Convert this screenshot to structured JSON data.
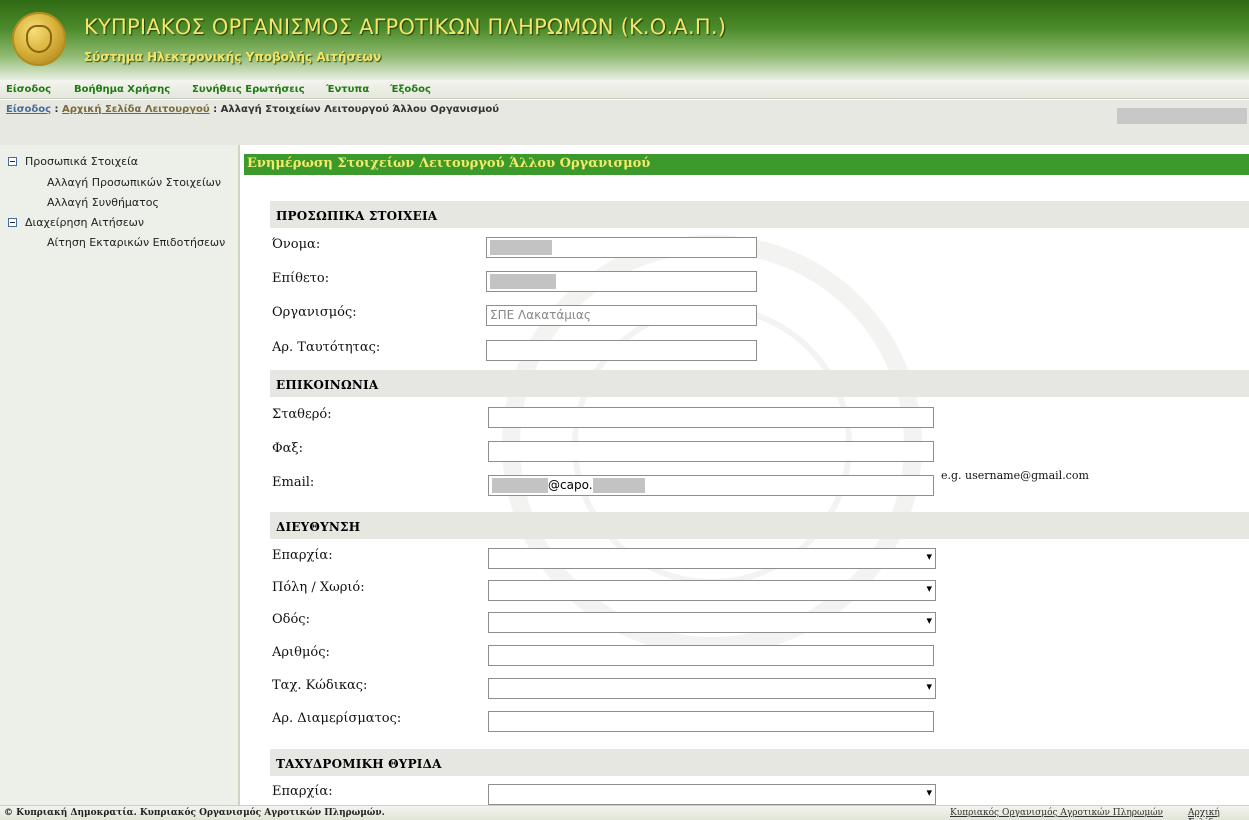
{
  "header": {
    "title": "ΚΥΠΡΙΑΚΟΣ ΟΡΓΑΝΙΣΜΟΣ ΑΓΡΟΤΙΚΩΝ ΠΛΗΡΩΜΩΝ (Κ.Ο.Α.Π.)",
    "subtitle": "Σύστημα Ηλεκτρονικής Υποβολής Αιτήσεων",
    "logo_icon": "coat-of-arms-seal-icon"
  },
  "top_menu": {
    "items": [
      "Είσοδος",
      "Βοήθημα Χρήσης",
      "Συνήθεις Ερωτήσεις",
      "Έντυπα",
      "Έξοδος"
    ]
  },
  "breadcrumb": {
    "first": "Είσοδος",
    "second": "Αρχική Σελίδα Λειτουργού",
    "current": "Αλλαγή Στοιχείων Λειτουργού Άλλου Οργανισμού",
    "separator": ":"
  },
  "sidebar": {
    "groups": [
      {
        "label": "Προσωπικά Στοιχεία",
        "items": [
          "Αλλαγή Προσωπικών Στοιχείων",
          "Αλλαγή Συνθήματος"
        ]
      },
      {
        "label": "Διαχείρηση Αιτήσεων",
        "items": [
          "Αίτηση Εκταρικών Επιδοτήσεων"
        ]
      }
    ]
  },
  "panel": {
    "title": "Ενημέρωση Στοιχείων Λειτουργού Άλλου Οργανισμού"
  },
  "sections": {
    "personal": {
      "title": "ΠΡΟΣΩΠΙΚΑ ΣΤΟΙΧΕΙΑ",
      "first_name_label": "Όνομα:",
      "last_name_label": "Επίθετο:",
      "organization_label": "Οργανισμός:",
      "organization_value": "ΣΠΕ Λακατάμιας",
      "id_number_label": "Αρ. Ταυτότητας:"
    },
    "contact": {
      "title": "ΕΠΙΚΟΙΝΩΝΙΑ",
      "phone_label": "Σταθερό:",
      "fax_label": "Φαξ:",
      "email_label": "Email:",
      "email_visible_part": "@capo.",
      "email_hint": "e.g. username@gmail.com"
    },
    "address": {
      "title": "ΔΙΕΥΘΥΝΣΗ",
      "district_label": "Επαρχία:",
      "city_label": "Πόλη / Χωριό:",
      "street_label": "Οδός:",
      "number_label": "Αριθμός:",
      "postcode_label": "Ταχ. Κώδικας:",
      "apartment_label": "Αρ. Διαμερίσματος:"
    },
    "pobox": {
      "title": "ΤΑΧΥΔΡΟΜΙΚΗ ΘΥΡΙΔΑ",
      "district_label": "Επαρχία:"
    }
  },
  "footer": {
    "copyright": "© Κυπριακή Δημοκρατία. Κυπριακός Οργανισμός Αγροτικών Πληρωμών.",
    "link_org": "Κυπριακός Οργανισμός Αγροτικών Πληρωμών",
    "link_home": "Αρχική Σελίδα"
  },
  "colors": {
    "header_green": "#2f6b14",
    "accent_yellow": "#f3e56a",
    "panel_green": "#3c9a2c",
    "menu_green": "#1f7a12"
  }
}
